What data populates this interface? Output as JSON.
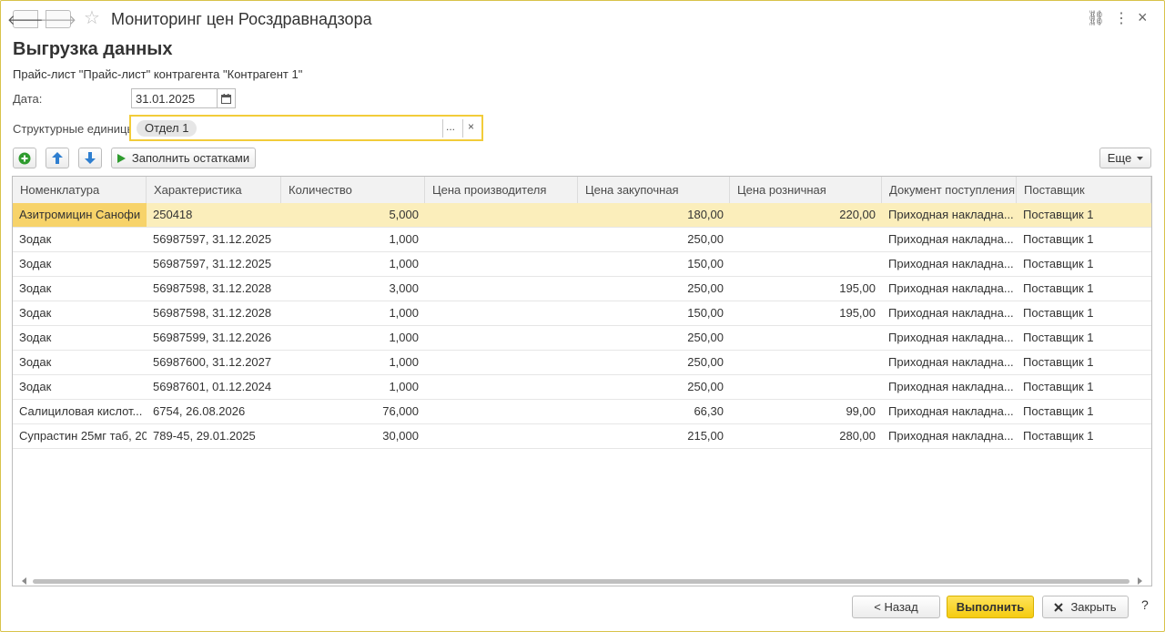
{
  "window": {
    "title": "Мониторинг цен Росздравнадзора",
    "back_glyph": "🡐",
    "forward_glyph": "🡒",
    "star_glyph": "☆",
    "link_glyph": "⛓",
    "menu_glyph": "⋮",
    "close_glyph": "×"
  },
  "page": {
    "title": "Выгрузка данных",
    "subtitle": "Прайс-лист \"Прайс-лист\" контрагента \"Контрагент 1\""
  },
  "form": {
    "date_label": "Дата:",
    "date_value": "31.01.2025",
    "units_label": "Структурные единицы:",
    "units_tag": "Отдел 1",
    "units_select": "...",
    "units_clear": "×"
  },
  "toolbar": {
    "fill_label": "Заполнить остатками",
    "more_label": "Еще"
  },
  "table": {
    "columns": [
      "Номенклатура",
      "Характеристика",
      "Количество",
      "Цена производителя",
      "Цена закупочная",
      "Цена розничная",
      "Документ поступления",
      "Поставщик"
    ],
    "rows": [
      {
        "nom": "Азитромицин Санофи",
        "char": "250418",
        "qty": "5,000",
        "price_mfr": "",
        "price_buy": "180,00",
        "price_retail": "220,00",
        "doc": "Приходная накладна...",
        "supplier": "Поставщик 1"
      },
      {
        "nom": "Зодак",
        "char": "56987597, 31.12.2025",
        "qty": "1,000",
        "price_mfr": "",
        "price_buy": "250,00",
        "price_retail": "",
        "doc": "Приходная накладна...",
        "supplier": "Поставщик 1"
      },
      {
        "nom": "Зодак",
        "char": "56987597, 31.12.2025",
        "qty": "1,000",
        "price_mfr": "",
        "price_buy": "150,00",
        "price_retail": "",
        "doc": "Приходная накладна...",
        "supplier": "Поставщик 1"
      },
      {
        "nom": "Зодак",
        "char": "56987598, 31.12.2028",
        "qty": "3,000",
        "price_mfr": "",
        "price_buy": "250,00",
        "price_retail": "195,00",
        "doc": "Приходная накладна...",
        "supplier": "Поставщик 1"
      },
      {
        "nom": "Зодак",
        "char": "56987598, 31.12.2028",
        "qty": "1,000",
        "price_mfr": "",
        "price_buy": "150,00",
        "price_retail": "195,00",
        "doc": "Приходная накладна...",
        "supplier": "Поставщик 1"
      },
      {
        "nom": "Зодак",
        "char": "56987599, 31.12.2026",
        "qty": "1,000",
        "price_mfr": "",
        "price_buy": "250,00",
        "price_retail": "",
        "doc": "Приходная накладна...",
        "supplier": "Поставщик 1"
      },
      {
        "nom": "Зодак",
        "char": "56987600, 31.12.2027",
        "qty": "1,000",
        "price_mfr": "",
        "price_buy": "250,00",
        "price_retail": "",
        "doc": "Приходная накладна...",
        "supplier": "Поставщик 1"
      },
      {
        "nom": "Зодак",
        "char": "56987601, 01.12.2024",
        "qty": "1,000",
        "price_mfr": "",
        "price_buy": "250,00",
        "price_retail": "",
        "doc": "Приходная накладна...",
        "supplier": "Поставщик 1"
      },
      {
        "nom": "Салициловая кислот...",
        "char": "6754, 26.08.2026",
        "qty": "76,000",
        "price_mfr": "",
        "price_buy": "66,30",
        "price_retail": "99,00",
        "doc": "Приходная накладна...",
        "supplier": "Поставщик 1"
      },
      {
        "nom": "Супрастин 25мг таб, 20",
        "char": "789-45, 29.01.2025",
        "qty": "30,000",
        "price_mfr": "",
        "price_buy": "215,00",
        "price_retail": "280,00",
        "doc": "Приходная накладна...",
        "supplier": "Поставщик 1"
      }
    ]
  },
  "footer": {
    "back_label": "< Назад",
    "run_label": "Выполнить",
    "close_label": "Закрыть",
    "help_label": "?"
  },
  "colors": {
    "accent_yellow": "#f5cc10",
    "selected_row": "#fbeebb",
    "add_green": "#2e9b2e",
    "arrow_blue": "#2f7fd0"
  }
}
